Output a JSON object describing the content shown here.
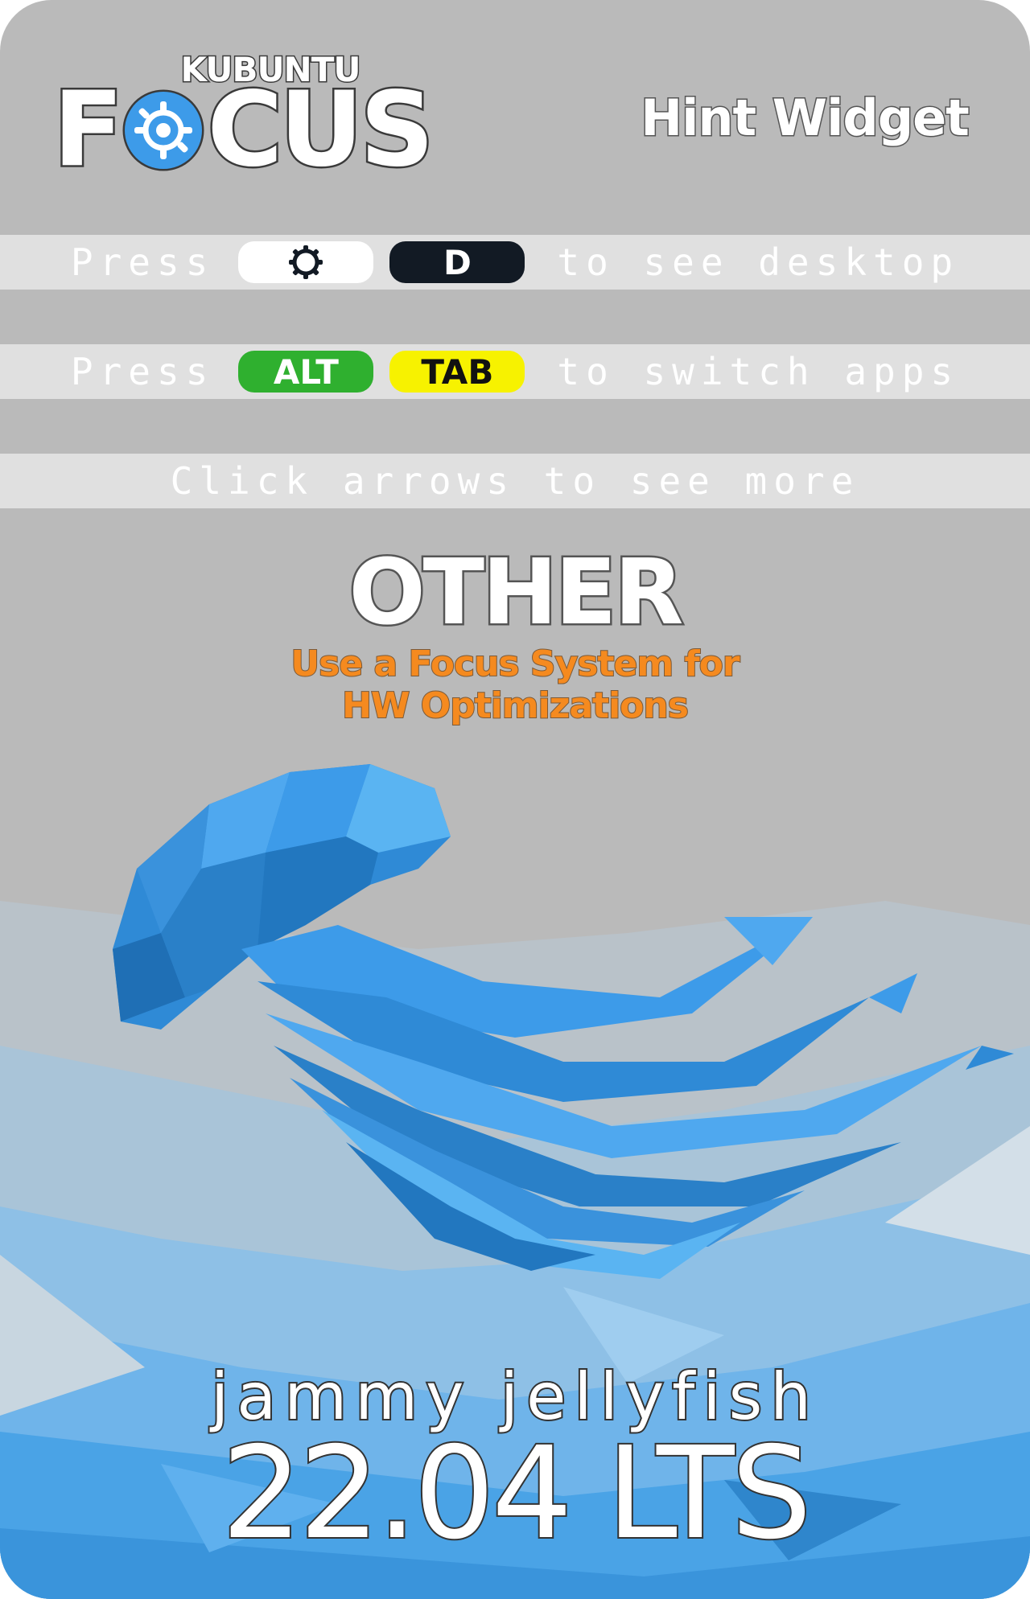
{
  "header": {
    "brand_small": "KUBUNTU",
    "brand_big_left": "F",
    "brand_big_right": "CUS",
    "widget_title": "Hint Widget"
  },
  "hints": [
    {
      "prefix": "Press",
      "key1": "meta-icon",
      "key2": "D",
      "suffix": "to see desktop"
    },
    {
      "prefix": "Press",
      "key1": "ALT",
      "key2": "TAB",
      "suffix": "to switch apps"
    }
  ],
  "navigation_hint": "Click arrows to see more",
  "tip": {
    "category": "OTHER",
    "line1": "Use a Focus System for",
    "line2": "HW Optimizations"
  },
  "release": {
    "codename": "jammy jellyfish",
    "version": "22.04 LTS"
  },
  "colors": {
    "card_bg": "#bababa",
    "accent_blue": "#3d9be9",
    "alt_key": "#2fb02f",
    "tab_key": "#f7f200",
    "d_key": "#121a24",
    "tip_text": "#f58a1f"
  },
  "icons": {
    "meta_key": "kubuntu-gear-icon",
    "brand_logo": "kubuntu-focus-logo-icon",
    "mascot": "jellyfish-illustration"
  }
}
